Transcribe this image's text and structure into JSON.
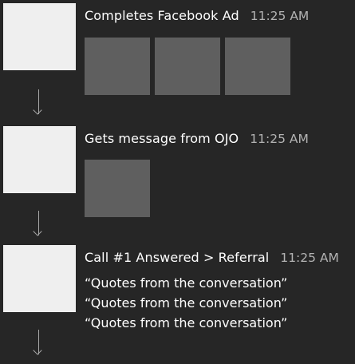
{
  "events": [
    {
      "title": "Completes Facebook Ad",
      "time": "11:25 AM",
      "thumbnail_count": 3
    },
    {
      "title": "Gets message from OJO",
      "time": "11:25 AM",
      "thumbnail_count": 1
    },
    {
      "title": "Call #1 Answered > Referral",
      "time": "11:25 AM",
      "quotes": [
        "“Quotes from the conversation”",
        "“Quotes from the conversation”",
        "“Quotes from the conversation”"
      ]
    }
  ],
  "colors": {
    "background": "#262626",
    "avatar": "#efefef",
    "thumbnail": "#5f5f5f",
    "timestamp": "#b3b3b3",
    "arrow": "#a8a8a8"
  },
  "icons": {
    "connector": "arrow-down-icon"
  }
}
